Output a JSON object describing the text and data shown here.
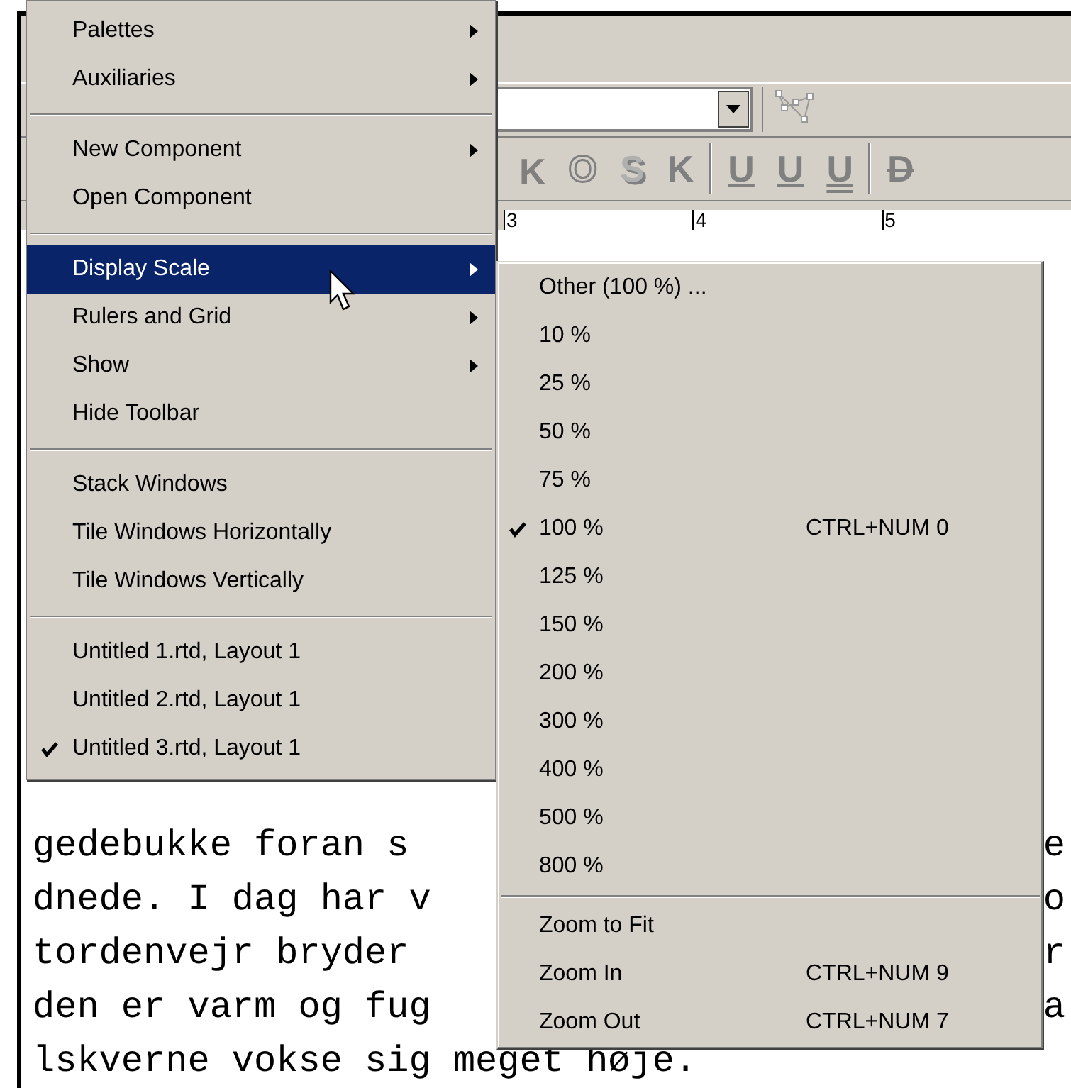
{
  "format_toolbar": [
    [
      {
        "label": "K",
        "kind": "smallcaps"
      },
      {
        "label": "O",
        "kind": "outline"
      },
      {
        "label": "S",
        "kind": "shadow"
      },
      {
        "label": "K",
        "kind": "plain"
      }
    ],
    [
      {
        "label": "U",
        "kind": "underline"
      },
      {
        "label": "U",
        "kind": "underline"
      },
      {
        "label": "U",
        "kind": "double_underline"
      }
    ],
    [
      {
        "label": "D",
        "kind": "strike"
      }
    ]
  ],
  "ruler": [
    "3",
    "4",
    "5"
  ],
  "document": [
    {
      "text": "gedebukke foran s",
      "tail": "e"
    },
    {
      "text": "dnede. I dag har v",
      "tail": "o"
    },
    {
      "text": "tordenvejr bryder",
      "tail": "r"
    },
    {
      "text": "den er varm og fug",
      "tail": "a"
    },
    {
      "text": "lskverne vokse sig meget høje."
    }
  ],
  "menu": {
    "groups": [
      [
        {
          "label": "Palettes",
          "submenu": true,
          "checked": false,
          "selected": false
        },
        {
          "label": "Auxiliaries",
          "submenu": true,
          "checked": false,
          "selected": false
        }
      ],
      [
        {
          "label": "New Component",
          "submenu": true,
          "checked": false,
          "selected": false
        },
        {
          "label": "Open Component",
          "submenu": false,
          "checked": false,
          "selected": false
        }
      ],
      [
        {
          "label": "Display Scale",
          "submenu": true,
          "checked": false,
          "selected": true
        },
        {
          "label": "Rulers and Grid",
          "submenu": true,
          "checked": false,
          "selected": false
        },
        {
          "label": "Show",
          "submenu": true,
          "checked": false,
          "selected": false
        },
        {
          "label": "Hide Toolbar",
          "submenu": false,
          "checked": false,
          "selected": false
        }
      ],
      [
        {
          "label": "Stack Windows",
          "submenu": false,
          "checked": false,
          "selected": false
        },
        {
          "label": "Tile Windows Horizontally",
          "submenu": false,
          "checked": false,
          "selected": false
        },
        {
          "label": "Tile Windows Vertically",
          "submenu": false,
          "checked": false,
          "selected": false
        }
      ],
      [
        {
          "label": "Untitled 1.rtd, Layout 1",
          "submenu": false,
          "checked": false,
          "selected": false
        },
        {
          "label": "Untitled 2.rtd, Layout 1",
          "submenu": false,
          "checked": false,
          "selected": false
        },
        {
          "label": "Untitled 3.rtd, Layout 1",
          "submenu": false,
          "checked": true,
          "selected": false
        }
      ]
    ]
  },
  "submenu": {
    "groups": [
      [
        {
          "label": "Other (100 %) ...",
          "checked": false
        },
        {
          "label": "10 %",
          "checked": false
        },
        {
          "label": "25 %",
          "checked": false
        },
        {
          "label": "50 %",
          "checked": false
        },
        {
          "label": "75 %",
          "checked": false
        },
        {
          "label": "100 %",
          "shortcut": "CTRL+NUM 0",
          "checked": true
        },
        {
          "label": "125 %",
          "checked": false
        },
        {
          "label": "150 %",
          "checked": false
        },
        {
          "label": "200 %",
          "checked": false
        },
        {
          "label": "300 %",
          "checked": false
        },
        {
          "label": "400 %",
          "checked": false
        },
        {
          "label": "500 %",
          "checked": false
        },
        {
          "label": "800 %",
          "checked": false
        }
      ],
      [
        {
          "label": "Zoom to Fit",
          "checked": false
        },
        {
          "label": "Zoom In",
          "shortcut": "CTRL+NUM 9",
          "checked": false
        },
        {
          "label": "Zoom Out",
          "shortcut": "CTRL+NUM 7",
          "checked": false
        }
      ]
    ]
  }
}
